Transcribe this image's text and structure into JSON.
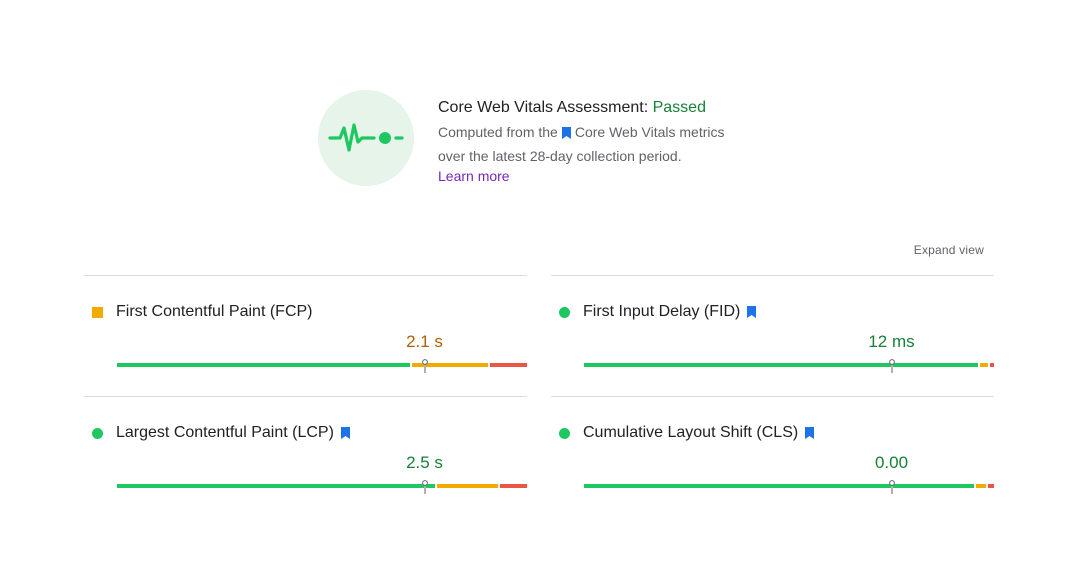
{
  "assessment": {
    "title_prefix": "Core Web Vitals Assessment: ",
    "status": "Passed",
    "desc_before": "Computed from the",
    "desc_link": "Core Web Vitals metrics",
    "desc_after": "over the latest 28-day collection period.",
    "learn_more": "Learn more"
  },
  "expand_view": "Expand view",
  "colors": {
    "good": "#1ec760",
    "needs_improvement": "#f2a900",
    "poor": "#eb5545",
    "status_good_text": "#188038",
    "status_avg_text": "#b06000",
    "bookmark": "#1a73e8",
    "link": "#7627bb"
  },
  "metrics": [
    {
      "name": "First Contentful Paint (FCP)",
      "value": "2.1 s",
      "rating": "needs-improvement",
      "core_vital": false,
      "distribution": {
        "good": 0.72,
        "needs_improvement": 0.19,
        "poor": 0.09
      },
      "percentile_position": 0.75
    },
    {
      "name": "First Input Delay (FID)",
      "value": "12 ms",
      "rating": "good",
      "core_vital": true,
      "distribution": {
        "good": 0.965,
        "needs_improvement": 0.025,
        "poor": 0.01
      },
      "percentile_position": 0.75
    },
    {
      "name": "Largest Contentful Paint (LCP)",
      "value": "2.5 s",
      "rating": "good",
      "core_vital": true,
      "distribution": {
        "good": 0.78,
        "needs_improvement": 0.155,
        "poor": 0.065
      },
      "percentile_position": 0.75
    },
    {
      "name": "Cumulative Layout Shift (CLS)",
      "value": "0.00",
      "rating": "good",
      "core_vital": true,
      "distribution": {
        "good": 0.955,
        "needs_improvement": 0.03,
        "poor": 0.015
      },
      "percentile_position": 0.75
    }
  ]
}
